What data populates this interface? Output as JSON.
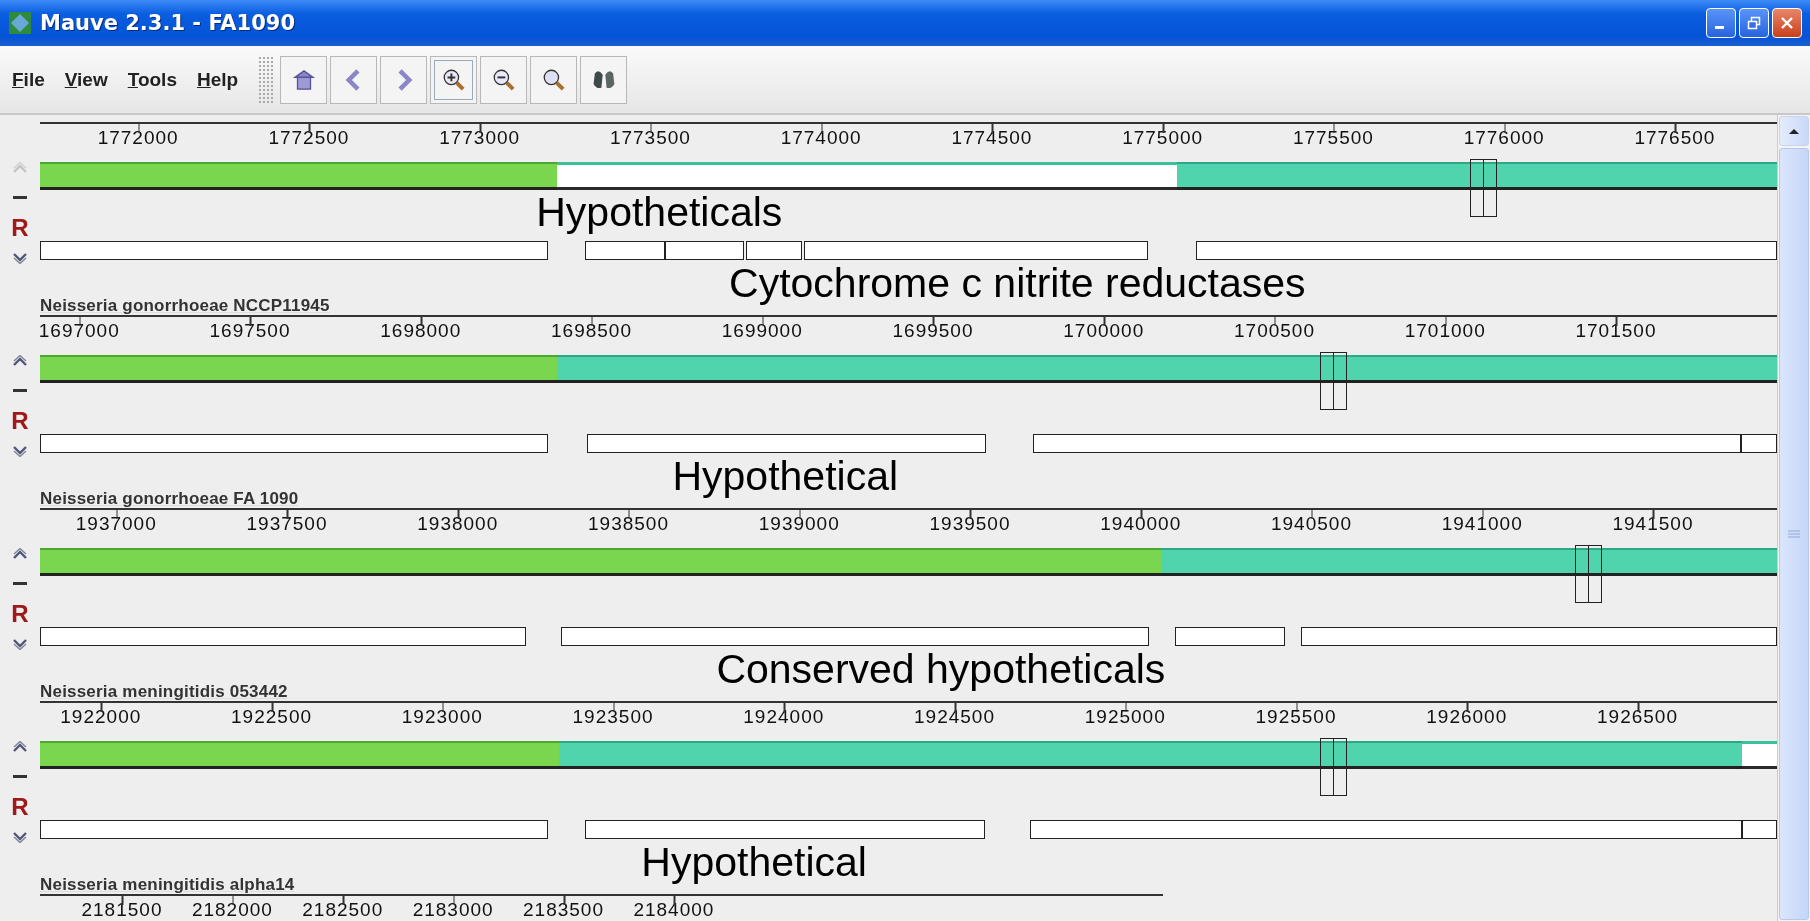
{
  "window": {
    "title": "Mauve 2.3.1 - FA1090"
  },
  "menu": [
    "File",
    "View",
    "Tools",
    "Help"
  ],
  "panels": [
    {
      "kind": "full",
      "move_up_disabled": true,
      "reverse_label": "R",
      "ticks": [
        "1772000",
        "1772500",
        "1773000",
        "1773500",
        "1774000",
        "1774500",
        "1775000",
        "1775500",
        "1776000",
        "1776500"
      ],
      "annotations": [
        "Hypotheticals",
        "Cytochrome c nitrite reductases"
      ]
    },
    {
      "kind": "full",
      "name": "Neisseria gonorrhoeae NCCP11945",
      "move_up_disabled": false,
      "reverse_label": "R",
      "ticks": [
        "1697000",
        "1697500",
        "1698000",
        "1698500",
        "1699000",
        "1699500",
        "1700000",
        "1700500",
        "1701000",
        "1701500"
      ],
      "annotations": [
        "Hypothetical"
      ]
    },
    {
      "kind": "full",
      "name": "Neisseria gonorrhoeae FA 1090",
      "move_up_disabled": false,
      "reverse_label": "R",
      "ticks": [
        "1937000",
        "1937500",
        "1938000",
        "1938500",
        "1939000",
        "1939500",
        "1940000",
        "1940500",
        "1941000",
        "1941500"
      ],
      "annotations": [
        "Conserved hypotheticals"
      ]
    },
    {
      "kind": "full",
      "name": "Neisseria meningitidis 053442",
      "move_up_disabled": false,
      "reverse_label": "R",
      "ticks": [
        "1922000",
        "1922500",
        "1923000",
        "1923500",
        "1924000",
        "1924500",
        "1925000",
        "1925500",
        "1926000",
        "1926500"
      ],
      "annotations": [
        "Hypothetical"
      ]
    },
    {
      "kind": "cut",
      "name": "Neisseria meningitidis alpha14",
      "ticks": [
        "2181500",
        "2182000",
        "2182500",
        "2183000",
        "2183500",
        "2184000"
      ]
    }
  ]
}
